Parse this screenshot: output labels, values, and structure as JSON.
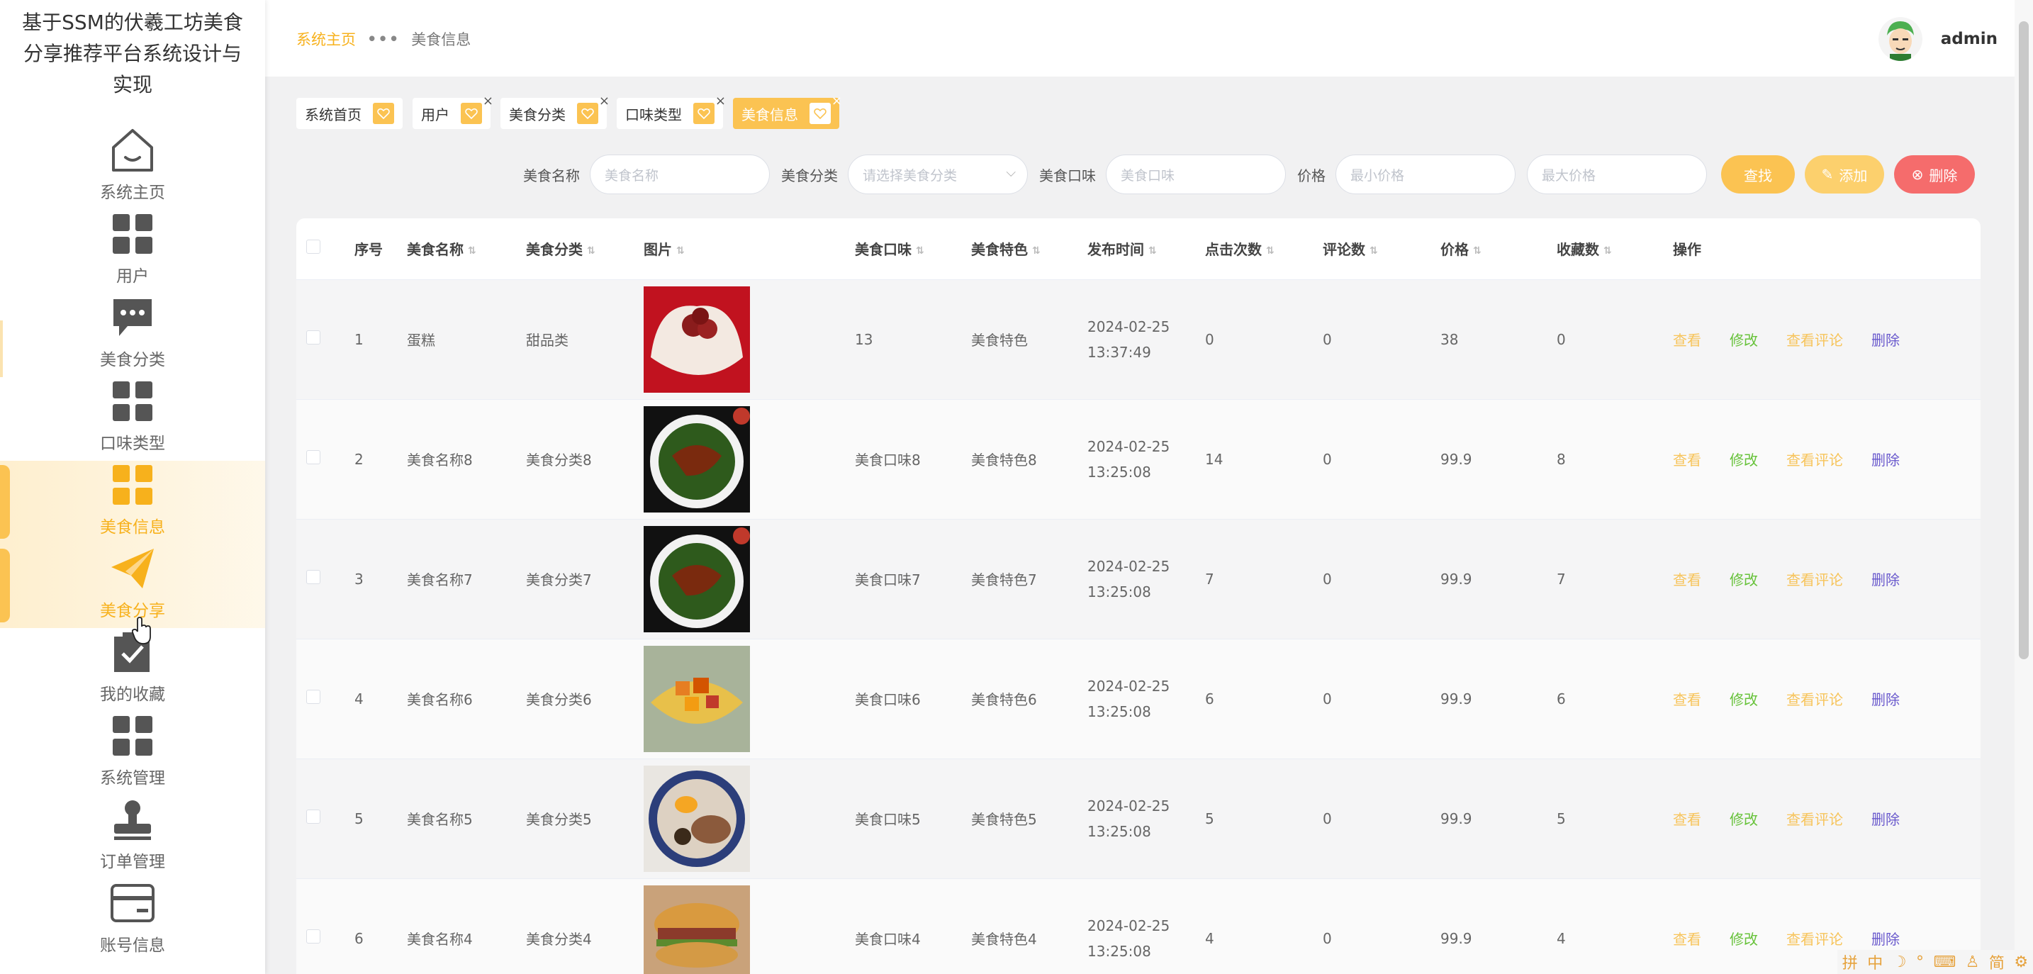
{
  "app": {
    "title": "基于SSM的伏羲工坊美食分享推荐平台系统设计与实现"
  },
  "sidebar": {
    "items": [
      {
        "label": "系统主页",
        "icon": "home-icon"
      },
      {
        "label": "用户",
        "icon": "grid-icon"
      },
      {
        "label": "美食分类",
        "icon": "chat-icon"
      },
      {
        "label": "口味类型",
        "icon": "grid-icon"
      },
      {
        "label": "美食信息",
        "icon": "grid-icon"
      },
      {
        "label": "美食分享",
        "icon": "paper-plane-icon"
      },
      {
        "label": "我的收藏",
        "icon": "checkbox-icon"
      },
      {
        "label": "系统管理",
        "icon": "grid-icon"
      },
      {
        "label": "订单管理",
        "icon": "stamp-icon"
      },
      {
        "label": "账号信息",
        "icon": "card-icon"
      }
    ]
  },
  "header": {
    "breadcrumb_home": "系统主页",
    "breadcrumb_sep": "•••",
    "breadcrumb_current": "美食信息",
    "username": "admin"
  },
  "tags": [
    {
      "label": "系统首页"
    },
    {
      "label": "用户"
    },
    {
      "label": "美食分类"
    },
    {
      "label": "口味类型"
    },
    {
      "label": "美食信息"
    }
  ],
  "search": {
    "name_label": "美食名称",
    "name_placeholder": "美食名称",
    "category_label": "美食分类",
    "category_placeholder": "请选择美食分类",
    "taste_label": "美食口味",
    "taste_placeholder": "美食口味",
    "price_label": "价格",
    "min_price_placeholder": "最小价格",
    "max_price_placeholder": "最大价格",
    "search_button": "查找",
    "add_button": "添加",
    "delete_button": "删除"
  },
  "table": {
    "columns": [
      "序号",
      "美食名称",
      "美食分类",
      "图片",
      "美食口味",
      "美食特色",
      "发布时间",
      "点击次数",
      "评论数",
      "价格",
      "收藏数",
      "操作"
    ],
    "actions": {
      "view": "查看",
      "edit": "修改",
      "comments": "查看评论",
      "delete": "删除"
    },
    "rows": [
      {
        "no": "1",
        "name": "蛋糕",
        "category": "甜品类",
        "taste": "13",
        "feature": "美食特色",
        "date": "2024-02-25",
        "time": "13:37:49",
        "clicks": "0",
        "comments": "0",
        "price": "38",
        "favorites": "0"
      },
      {
        "no": "2",
        "name": "美食名称8",
        "category": "美食分类8",
        "taste": "美食口味8",
        "feature": "美食特色8",
        "date": "2024-02-25",
        "time": "13:25:08",
        "clicks": "14",
        "comments": "0",
        "price": "99.9",
        "favorites": "8"
      },
      {
        "no": "3",
        "name": "美食名称7",
        "category": "美食分类7",
        "taste": "美食口味7",
        "feature": "美食特色7",
        "date": "2024-02-25",
        "time": "13:25:08",
        "clicks": "7",
        "comments": "0",
        "price": "99.9",
        "favorites": "7"
      },
      {
        "no": "4",
        "name": "美食名称6",
        "category": "美食分类6",
        "taste": "美食口味6",
        "feature": "美食特色6",
        "date": "2024-02-25",
        "time": "13:25:08",
        "clicks": "6",
        "comments": "0",
        "price": "99.9",
        "favorites": "6"
      },
      {
        "no": "5",
        "name": "美食名称5",
        "category": "美食分类5",
        "taste": "美食口味5",
        "feature": "美食特色5",
        "date": "2024-02-25",
        "time": "13:25:08",
        "clicks": "5",
        "comments": "0",
        "price": "99.9",
        "favorites": "5"
      },
      {
        "no": "6",
        "name": "美食名称4",
        "category": "美食分类4",
        "taste": "美食口味4",
        "feature": "美食特色4",
        "date": "2024-02-25",
        "time": "13:25:08",
        "clicks": "4",
        "comments": "0",
        "price": "99.9",
        "favorites": "4"
      }
    ]
  },
  "tray": {
    "items": [
      "拼",
      "中",
      "简"
    ]
  },
  "colors": {
    "accent": "#fbc352",
    "danger": "#f56c6c",
    "success": "#67c23a",
    "link_purple": "#6a5acd"
  }
}
